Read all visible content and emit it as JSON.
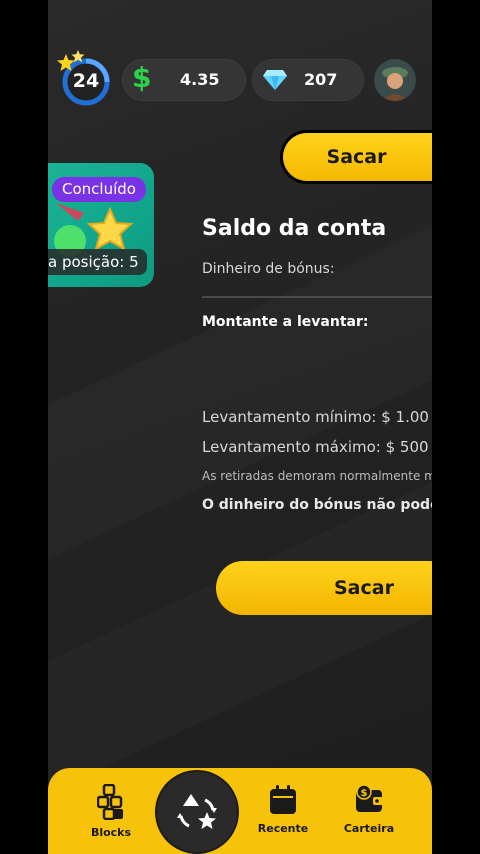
{
  "header": {
    "level": "24",
    "cash_amount": "4.35",
    "gems_amount": "207"
  },
  "withdraw_top_label": "Sacar",
  "game_card": {
    "status_badge": "Concluído",
    "position_text": "a posição: 5"
  },
  "balance": {
    "title": "Saldo da conta",
    "bonus_label": "Dinheiro de bónus:",
    "amount_to_withdraw": "Montante a levantar:",
    "min_withdraw": "Levantamento mínimo: $ 1.00",
    "max_withdraw": "Levantamento máximo: $ 500",
    "note": "As retiradas demoram normalmente me",
    "bonus_warning": "O dinheiro do bónus não pode s"
  },
  "withdraw_main_label": "Sacar",
  "bottom_nav": {
    "blocks": "Blocks",
    "recent": "Recente",
    "wallet": "Carteira"
  },
  "colors": {
    "accent_yellow": "#f7c30a",
    "card_green": "#11a78c",
    "badge_purple": "#7a32e6",
    "cash_green": "#2bd24a",
    "gem_blue": "#62d6ff"
  }
}
